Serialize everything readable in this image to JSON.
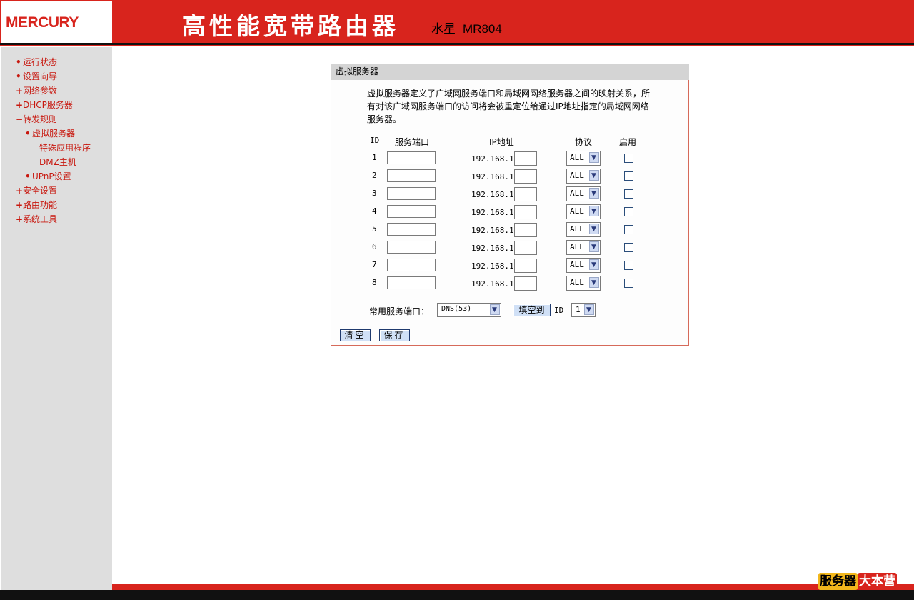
{
  "header": {
    "logo": "MERCURY",
    "title": "高性能宽带路由器",
    "brand_cn": "水星",
    "model": "MR804"
  },
  "sidebar": {
    "items": [
      {
        "marker": "•",
        "label": "运行状态"
      },
      {
        "marker": "•",
        "label": "设置向导"
      },
      {
        "marker": "+",
        "label": "网络参数"
      },
      {
        "marker": "+",
        "label": "DHCP服务器"
      },
      {
        "marker": "−",
        "label": "转发规则"
      },
      {
        "marker": "•",
        "label": "虚拟服务器"
      },
      {
        "marker": "",
        "label": "特殊应用程序"
      },
      {
        "marker": "",
        "label": "DMZ主机"
      },
      {
        "marker": "•",
        "label": "UPnP设置"
      },
      {
        "marker": "+",
        "label": "安全设置"
      },
      {
        "marker": "+",
        "label": "路由功能"
      },
      {
        "marker": "+",
        "label": "系统工具"
      }
    ]
  },
  "panel": {
    "title": "虚拟服务器",
    "description": "虚拟服务器定义了广域网服务端口和局域网网络服务器之间的映射关系，所有对该广域网服务端口的访问将会被重定位给通过IP地址指定的局域网网络服务器。",
    "columns": {
      "id": "ID",
      "port": "服务端口",
      "ip": "IP地址",
      "protocol": "协议",
      "enable": "启用"
    },
    "ip_prefix": "192.168.1.",
    "rows": [
      {
        "id": "1",
        "port": "",
        "ip_last": "",
        "protocol": "ALL",
        "enabled": false
      },
      {
        "id": "2",
        "port": "",
        "ip_last": "",
        "protocol": "ALL",
        "enabled": false
      },
      {
        "id": "3",
        "port": "",
        "ip_last": "",
        "protocol": "ALL",
        "enabled": false
      },
      {
        "id": "4",
        "port": "",
        "ip_last": "",
        "protocol": "ALL",
        "enabled": false
      },
      {
        "id": "5",
        "port": "",
        "ip_last": "",
        "protocol": "ALL",
        "enabled": false
      },
      {
        "id": "6",
        "port": "",
        "ip_last": "",
        "protocol": "ALL",
        "enabled": false
      },
      {
        "id": "7",
        "port": "",
        "ip_last": "",
        "protocol": "ALL",
        "enabled": false
      },
      {
        "id": "8",
        "port": "",
        "ip_last": "",
        "protocol": "ALL",
        "enabled": false
      }
    ],
    "common_port_label": "常用服务端口：",
    "common_port_value": "DNS(53)",
    "fill_button": "填空到",
    "id_label": "ID",
    "id_value": "1",
    "clear_button": "清空",
    "save_button": "保存"
  },
  "watermark": {
    "left": "服务器",
    "right": "大本营"
  },
  "colors": {
    "brand_red": "#d8241d",
    "sidebar_bg": "#dedede",
    "nav_text": "#c8180f",
    "panel_border": "#d66a5a",
    "button_bg": "#d0e0f6"
  }
}
